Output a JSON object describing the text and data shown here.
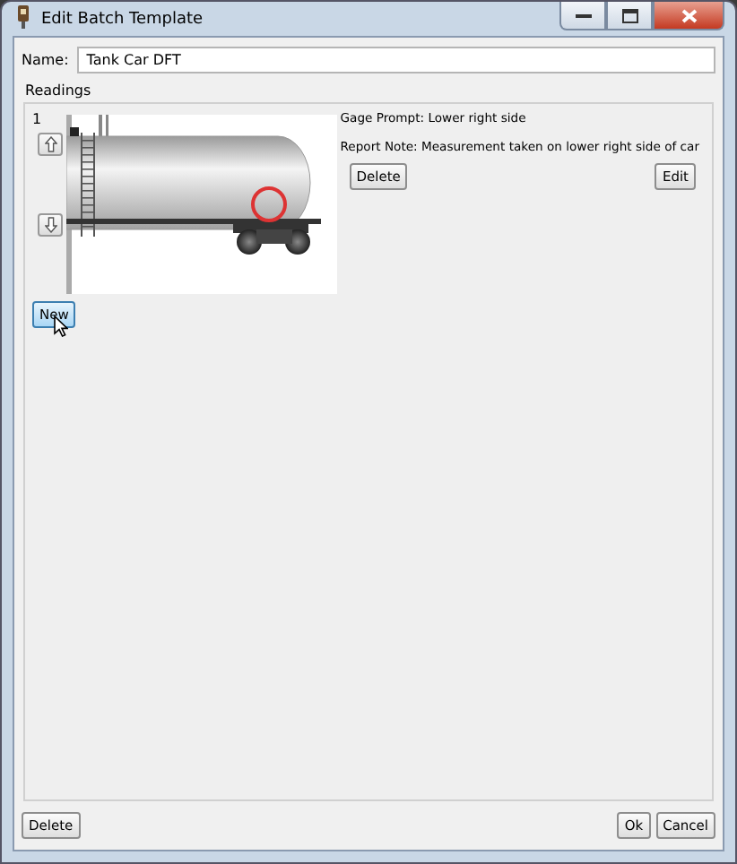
{
  "window": {
    "title": "Edit Batch Template"
  },
  "name_field": {
    "label": "Name:",
    "value": "Tank Car DFT"
  },
  "readings": {
    "title": "Readings",
    "items": [
      {
        "number": "1",
        "gage_prompt": "Gage Prompt: Lower right side",
        "report_note": "Report Note: Measurement taken on lower right side of car",
        "delete_label": "Delete",
        "edit_label": "Edit"
      }
    ],
    "new_label": "New"
  },
  "buttons": {
    "delete": "Delete",
    "ok": "Ok",
    "cancel": "Cancel"
  }
}
